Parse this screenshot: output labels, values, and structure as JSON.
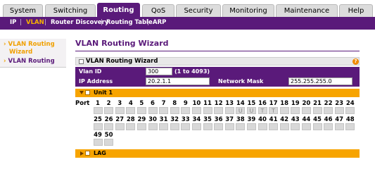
{
  "tabs": [
    {
      "label": "System",
      "active": false
    },
    {
      "label": "Switching",
      "active": false
    },
    {
      "label": "Routing",
      "active": true
    },
    {
      "label": "QoS",
      "active": false
    },
    {
      "label": "Security",
      "active": false
    },
    {
      "label": "Monitoring",
      "active": false
    },
    {
      "label": "Maintenance",
      "active": false
    },
    {
      "label": "Help",
      "active": false
    }
  ],
  "subnav": {
    "items": [
      "IP",
      "VLAN",
      "Router Discovery",
      "Routing Table",
      "ARP"
    ],
    "selected": "VLAN",
    "separator": "|"
  },
  "sidebar": {
    "items": [
      {
        "label_line1": "VLAN Routing",
        "label_line2": "Wizard",
        "current": false
      },
      {
        "label_line1": "VLAN Routing",
        "current": true
      }
    ]
  },
  "page": {
    "title": "VLAN Routing Wizard",
    "wizard_header": "VLAN Routing Wizard",
    "help_icon": "?"
  },
  "form": {
    "vlan_id_label": "Vlan ID",
    "vlan_id_value": "300",
    "vlan_id_range": "(1 to 4093)",
    "ip_label": "IP Address",
    "ip_value": "20.2.1.1",
    "mask_label": "Network Mask",
    "mask_value": "255.255.255.0"
  },
  "unit": {
    "label": "Unit 1",
    "port_label": "Port",
    "ports_row1": [
      "1",
      "2",
      "3",
      "4",
      "5",
      "6",
      "7",
      "8",
      "9",
      "10",
      "11",
      "12",
      "13",
      "14",
      "15",
      "16",
      "17",
      "18",
      "19",
      "20",
      "21",
      "22",
      "23",
      "24"
    ],
    "ports_row2": [
      "25",
      "26",
      "27",
      "28",
      "29",
      "30",
      "31",
      "32",
      "33",
      "34",
      "35",
      "36",
      "37",
      "38",
      "39",
      "40",
      "41",
      "42",
      "43",
      "44",
      "45",
      "46",
      "47",
      "48"
    ],
    "ports_row3": [
      "49",
      "50"
    ],
    "port_states_row1": [
      "",
      "",
      "",
      "",
      "",
      "",
      "",
      "",
      "",
      "",
      "",
      "",
      "",
      "U",
      "U",
      "T",
      "T",
      "",
      "",
      "",
      "",
      "",
      "",
      ""
    ]
  },
  "lag": {
    "label": "LAG"
  }
}
